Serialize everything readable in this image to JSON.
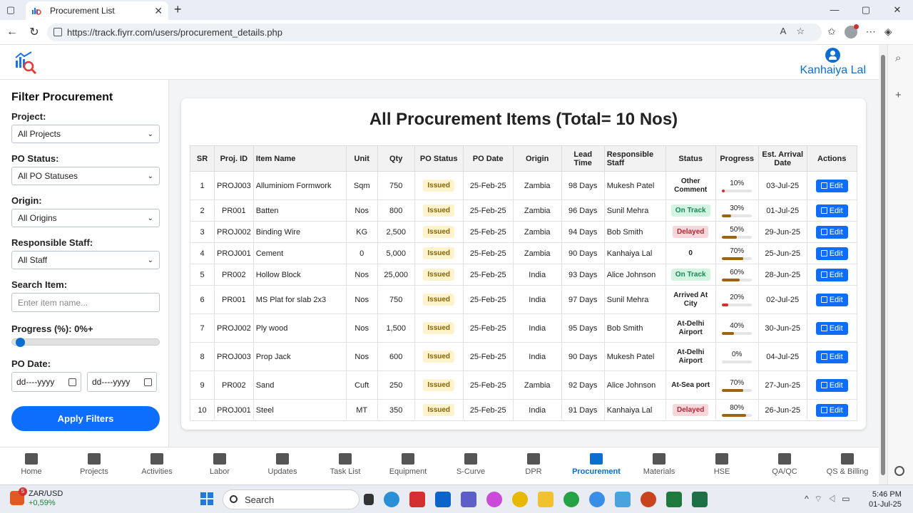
{
  "browser": {
    "tab_title": "Procurement List",
    "url": "https://track.fiyrr.com/users/procurement_details.php"
  },
  "header": {
    "user_name": "Kanhaiya Lal"
  },
  "filter": {
    "title": "Filter Procurement",
    "project_label": "Project:",
    "project_value": "All Projects",
    "po_status_label": "PO Status:",
    "po_status_value": "All PO Statuses",
    "origin_label": "Origin:",
    "origin_value": "All Origins",
    "staff_label": "Responsible Staff:",
    "staff_value": "All Staff",
    "search_label": "Search Item:",
    "search_placeholder": "Enter item name...",
    "progress_label": "Progress (%): 0%+",
    "progress_value": 0,
    "po_date_label": "PO Date:",
    "date_from_placeholder": "dd----yyyy",
    "date_to_placeholder": "dd----yyyy",
    "apply_label": "Apply Filters"
  },
  "main": {
    "title": "All Procurement Items (Total= 10 Nos)",
    "columns": [
      "SR",
      "Proj. ID",
      "Item Name",
      "Unit",
      "Qty",
      "PO Status",
      "PO Date",
      "Origin",
      "Lead Time",
      "Responsible Staff",
      "Status",
      "Progress",
      "Est. Arrival Date",
      "Actions"
    ],
    "edit_label": "Edit",
    "rows": [
      {
        "sr": "1",
        "proj": "PROJ003",
        "item": "Alluminiom Formwork",
        "unit": "Sqm",
        "qty": "750",
        "po_status": "Issued",
        "po_date": "25-Feb-25",
        "origin": "Zambia",
        "lead": "98 Days",
        "staff": "Mukesh Patel",
        "status": "Other Comment",
        "status_type": "plain",
        "progress": 10,
        "progress_label": "10%",
        "eta": "03-Jul-25"
      },
      {
        "sr": "2",
        "proj": "PR001",
        "item": "Batten",
        "unit": "Nos",
        "qty": "800",
        "po_status": "Issued",
        "po_date": "25-Feb-25",
        "origin": "Zambia",
        "lead": "96 Days",
        "staff": "Sunil Mehra",
        "status": "On Track",
        "status_type": "green",
        "progress": 30,
        "progress_label": "30%",
        "eta": "01-Jul-25"
      },
      {
        "sr": "3",
        "proj": "PROJ002",
        "item": "Binding Wire",
        "unit": "KG",
        "qty": "2,500",
        "po_status": "Issued",
        "po_date": "25-Feb-25",
        "origin": "Zambia",
        "lead": "94 Days",
        "staff": "Bob Smith",
        "status": "Delayed",
        "status_type": "red",
        "progress": 50,
        "progress_label": "50%",
        "eta": "29-Jun-25"
      },
      {
        "sr": "4",
        "proj": "PROJ001",
        "item": "Cement",
        "unit": "0",
        "qty": "5,000",
        "po_status": "Issued",
        "po_date": "25-Feb-25",
        "origin": "Zambia",
        "lead": "90 Days",
        "staff": "Kanhaiya Lal",
        "status": "0",
        "status_type": "plain",
        "progress": 70,
        "progress_label": "70%",
        "eta": "25-Jun-25"
      },
      {
        "sr": "5",
        "proj": "PR002",
        "item": "Hollow Block",
        "unit": "Nos",
        "qty": "25,000",
        "po_status": "Issued",
        "po_date": "25-Feb-25",
        "origin": "India",
        "lead": "93 Days",
        "staff": "Alice Johnson",
        "status": "On Track",
        "status_type": "green",
        "progress": 60,
        "progress_label": "60%",
        "eta": "28-Jun-25"
      },
      {
        "sr": "6",
        "proj": "PR001",
        "item": "MS Plat for slab 2x3",
        "unit": "Nos",
        "qty": "750",
        "po_status": "Issued",
        "po_date": "25-Feb-25",
        "origin": "India",
        "lead": "97 Days",
        "staff": "Sunil Mehra",
        "status": "Arrived At City",
        "status_type": "plain",
        "progress": 20,
        "progress_label": "20%",
        "eta": "02-Jul-25"
      },
      {
        "sr": "7",
        "proj": "PROJ002",
        "item": "Ply wood",
        "unit": "Nos",
        "qty": "1,500",
        "po_status": "Issued",
        "po_date": "25-Feb-25",
        "origin": "India",
        "lead": "95 Days",
        "staff": "Bob Smith",
        "status": "At-Delhi Airport",
        "status_type": "plain",
        "progress": 40,
        "progress_label": "40%",
        "eta": "30-Jun-25"
      },
      {
        "sr": "8",
        "proj": "PROJ003",
        "item": "Prop Jack",
        "unit": "Nos",
        "qty": "600",
        "po_status": "Issued",
        "po_date": "25-Feb-25",
        "origin": "India",
        "lead": "90 Days",
        "staff": "Mukesh Patel",
        "status": "At-Delhi Airport",
        "status_type": "plain",
        "progress": 0,
        "progress_label": "0%",
        "eta": "04-Jul-25"
      },
      {
        "sr": "9",
        "proj": "PR002",
        "item": "Sand",
        "unit": "Cuft",
        "qty": "250",
        "po_status": "Issued",
        "po_date": "25-Feb-25",
        "origin": "Zambia",
        "lead": "92 Days",
        "staff": "Alice Johnson",
        "status": "At-Sea port",
        "status_type": "plain",
        "progress": 70,
        "progress_label": "70%",
        "eta": "27-Jun-25"
      },
      {
        "sr": "10",
        "proj": "PROJ001",
        "item": "Steel",
        "unit": "MT",
        "qty": "350",
        "po_status": "Issued",
        "po_date": "25-Feb-25",
        "origin": "India",
        "lead": "91 Days",
        "staff": "Kanhaiya Lal",
        "status": "Delayed",
        "status_type": "red",
        "progress": 80,
        "progress_label": "80%",
        "eta": "26-Jun-25"
      }
    ]
  },
  "bottom_nav": [
    {
      "label": "Home",
      "icon": "home-icon"
    },
    {
      "label": "Projects",
      "icon": "projects-icon"
    },
    {
      "label": "Activities",
      "icon": "activities-icon"
    },
    {
      "label": "Labor",
      "icon": "labor-icon"
    },
    {
      "label": "Updates",
      "icon": "updates-icon"
    },
    {
      "label": "Task List",
      "icon": "task-list-icon"
    },
    {
      "label": "Equipment",
      "icon": "equipment-icon"
    },
    {
      "label": "S-Curve",
      "icon": "s-curve-icon"
    },
    {
      "label": "DPR",
      "icon": "dpr-icon"
    },
    {
      "label": "Procurement",
      "icon": "procurement-icon",
      "active": true
    },
    {
      "label": "Materials",
      "icon": "materials-icon"
    },
    {
      "label": "HSE",
      "icon": "hse-icon"
    },
    {
      "label": "QA/QC",
      "icon": "qa-qc-icon"
    },
    {
      "label": "QS & Billing",
      "icon": "qs-billing-icon"
    }
  ],
  "taskbar": {
    "weather_label": "ZAR/USD",
    "weather_change": "+0,59%",
    "weather_badge": "5",
    "search_label": "Search",
    "time": "5:46 PM",
    "date": "01-Jul-25"
  },
  "colors": {
    "primary": "#0d6efd",
    "issued_bg": "#fff3cd",
    "green_bg": "#d4f4e2",
    "red_bg": "#f8d7da",
    "progress_low": "#d32f2f",
    "progress_mid": "#a0620c"
  }
}
